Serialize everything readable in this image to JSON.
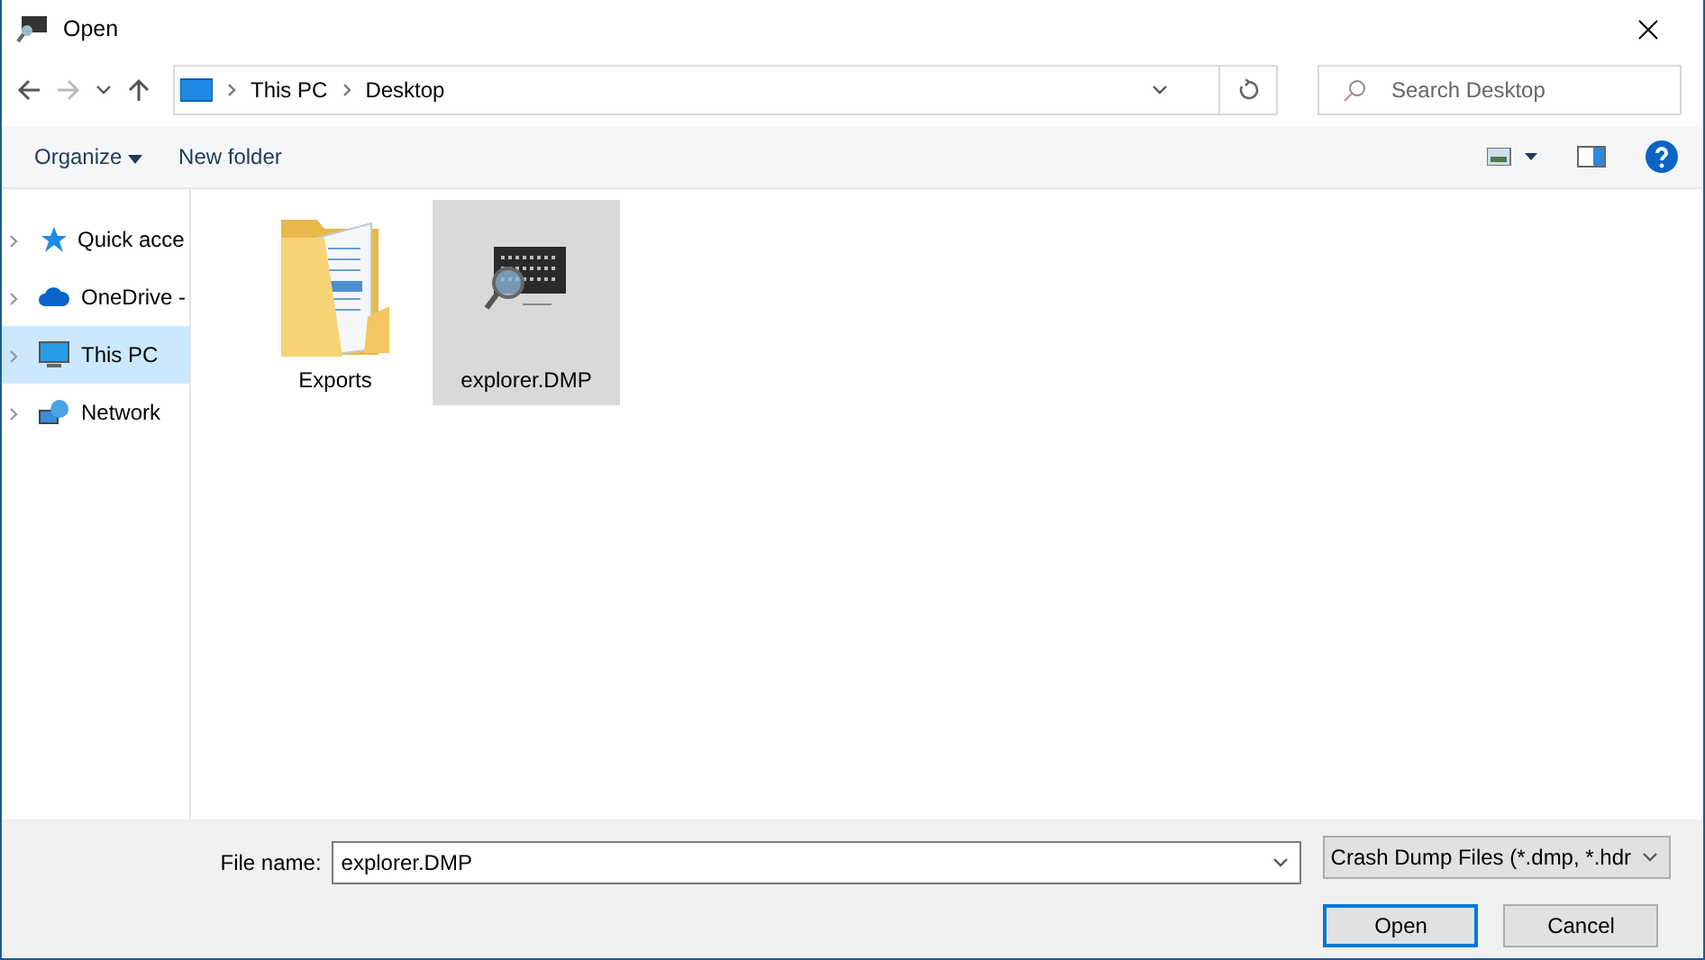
{
  "window": {
    "title": "Open"
  },
  "address": {
    "crumbs": [
      "This PC",
      "Desktop"
    ]
  },
  "search": {
    "placeholder": "Search Desktop"
  },
  "toolbar": {
    "organize": "Organize",
    "new_folder": "New folder"
  },
  "sidebar": {
    "items": [
      {
        "label": "Quick acce",
        "kind": "star",
        "selected": false
      },
      {
        "label": "OneDrive -",
        "kind": "cloud",
        "selected": false
      },
      {
        "label": "This PC",
        "kind": "pc",
        "selected": true
      },
      {
        "label": "Network",
        "kind": "network",
        "selected": false
      }
    ]
  },
  "files": [
    {
      "name": "Exports",
      "kind": "folder",
      "selected": false
    },
    {
      "name": "explorer.DMP",
      "kind": "dump",
      "selected": true
    }
  ],
  "footer": {
    "file_name_label": "File name:",
    "file_name": "explorer.DMP",
    "file_type": "Crash Dump Files (*.dmp, *.hdr",
    "open": "Open",
    "cancel": "Cancel"
  }
}
